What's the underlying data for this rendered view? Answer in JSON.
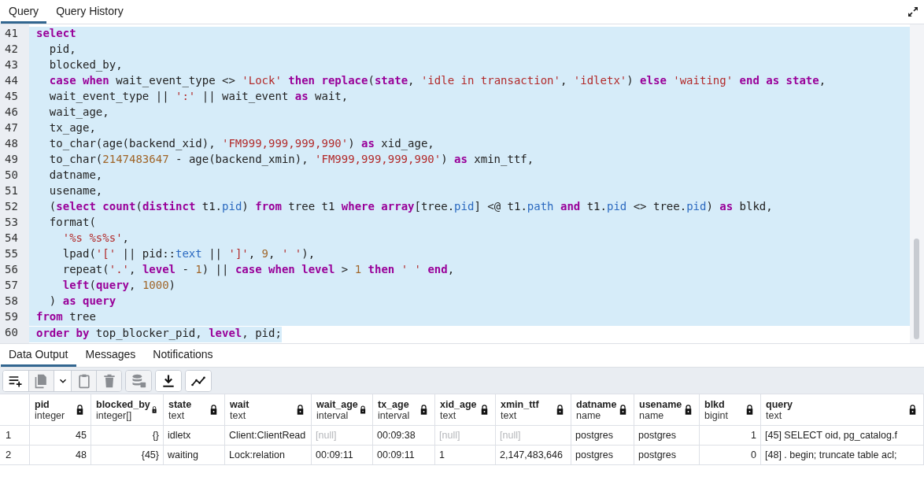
{
  "top_tabs": [
    {
      "label": "Query",
      "selected": true
    },
    {
      "label": "Query History",
      "selected": false
    }
  ],
  "editor": {
    "lines": [
      {
        "n": "41",
        "selected": true,
        "tokens": [
          {
            "kind": "kw",
            "text": "select"
          }
        ]
      },
      {
        "n": "42",
        "selected": true,
        "tokens": [
          {
            "kind": "p",
            "text": "  pid,"
          }
        ]
      },
      {
        "n": "43",
        "selected": true,
        "tokens": [
          {
            "kind": "p",
            "text": "  blocked_by,"
          }
        ]
      },
      {
        "n": "44",
        "selected": true,
        "tokens": [
          {
            "kind": "kw",
            "text": "  case when "
          },
          {
            "kind": "p",
            "text": "wait_event_type <> "
          },
          {
            "kind": "str",
            "text": "'Lock' "
          },
          {
            "kind": "kw",
            "text": "then replace"
          },
          {
            "kind": "p",
            "text": "("
          },
          {
            "kind": "kw",
            "text": "state"
          },
          {
            "kind": "p",
            "text": ", "
          },
          {
            "kind": "str",
            "text": "'idle in transaction'"
          },
          {
            "kind": "p",
            "text": ", "
          },
          {
            "kind": "str",
            "text": "'idletx'"
          },
          {
            "kind": "p",
            "text": ") "
          },
          {
            "kind": "kw",
            "text": "else "
          },
          {
            "kind": "str",
            "text": "'waiting' "
          },
          {
            "kind": "kw",
            "text": "end as state"
          },
          {
            "kind": "p",
            "text": ","
          }
        ]
      },
      {
        "n": "45",
        "selected": true,
        "tokens": [
          {
            "kind": "p",
            "text": "  wait_event_type || "
          },
          {
            "kind": "str",
            "text": "':'"
          },
          {
            "kind": "p",
            "text": " || wait_event "
          },
          {
            "kind": "kw",
            "text": "as"
          },
          {
            "kind": "p",
            "text": " wait,"
          }
        ]
      },
      {
        "n": "46",
        "selected": true,
        "tokens": [
          {
            "kind": "p",
            "text": "  wait_age,"
          }
        ]
      },
      {
        "n": "47",
        "selected": true,
        "tokens": [
          {
            "kind": "p",
            "text": "  tx_age,"
          }
        ]
      },
      {
        "n": "48",
        "selected": true,
        "tokens": [
          {
            "kind": "p",
            "text": "  to_char(age(backend_xid), "
          },
          {
            "kind": "str",
            "text": "'FM999,999,999,990'"
          },
          {
            "kind": "p",
            "text": ") "
          },
          {
            "kind": "kw",
            "text": "as"
          },
          {
            "kind": "p",
            "text": " xid_age,"
          }
        ]
      },
      {
        "n": "49",
        "selected": true,
        "tokens": [
          {
            "kind": "p",
            "text": "  to_char("
          },
          {
            "kind": "num",
            "text": "2147483647"
          },
          {
            "kind": "p",
            "text": " - age(backend_xmin), "
          },
          {
            "kind": "str",
            "text": "'FM999,999,999,990'"
          },
          {
            "kind": "p",
            "text": ") "
          },
          {
            "kind": "kw",
            "text": "as"
          },
          {
            "kind": "p",
            "text": " xmin_ttf,"
          }
        ]
      },
      {
        "n": "50",
        "selected": true,
        "tokens": [
          {
            "kind": "p",
            "text": "  datname,"
          }
        ]
      },
      {
        "n": "51",
        "selected": true,
        "tokens": [
          {
            "kind": "p",
            "text": "  usename,"
          }
        ]
      },
      {
        "n": "52",
        "selected": true,
        "tokens": [
          {
            "kind": "p",
            "text": "  ("
          },
          {
            "kind": "kw",
            "text": "select count"
          },
          {
            "kind": "p",
            "text": "("
          },
          {
            "kind": "kw",
            "text": "distinct"
          },
          {
            "kind": "p",
            "text": " t1."
          },
          {
            "kind": "ty",
            "text": "pid"
          },
          {
            "kind": "p",
            "text": ") "
          },
          {
            "kind": "kw",
            "text": "from"
          },
          {
            "kind": "p",
            "text": " tree t1 "
          },
          {
            "kind": "kw",
            "text": "where array"
          },
          {
            "kind": "p",
            "text": "[tree."
          },
          {
            "kind": "ty",
            "text": "pid"
          },
          {
            "kind": "p",
            "text": "] <@ t1."
          },
          {
            "kind": "ty",
            "text": "path"
          },
          {
            "kind": "kw",
            "text": " and"
          },
          {
            "kind": "p",
            "text": " t1."
          },
          {
            "kind": "ty",
            "text": "pid"
          },
          {
            "kind": "p",
            "text": " <> tree."
          },
          {
            "kind": "ty",
            "text": "pid"
          },
          {
            "kind": "p",
            "text": ") "
          },
          {
            "kind": "kw",
            "text": "as"
          },
          {
            "kind": "p",
            "text": " blkd,"
          }
        ]
      },
      {
        "n": "53",
        "selected": true,
        "tokens": [
          {
            "kind": "p",
            "text": "  format("
          }
        ]
      },
      {
        "n": "54",
        "selected": true,
        "tokens": [
          {
            "kind": "str",
            "text": "    '%s %s%s'"
          },
          {
            "kind": "p",
            "text": ","
          }
        ]
      },
      {
        "n": "55",
        "selected": true,
        "tokens": [
          {
            "kind": "p",
            "text": "    lpad("
          },
          {
            "kind": "str",
            "text": "'['"
          },
          {
            "kind": "p",
            "text": " || pid::"
          },
          {
            "kind": "ty",
            "text": "text"
          },
          {
            "kind": "p",
            "text": " || "
          },
          {
            "kind": "str",
            "text": "']'"
          },
          {
            "kind": "p",
            "text": ", "
          },
          {
            "kind": "num",
            "text": "9"
          },
          {
            "kind": "p",
            "text": ", "
          },
          {
            "kind": "str",
            "text": "' '"
          },
          {
            "kind": "p",
            "text": "),"
          }
        ]
      },
      {
        "n": "56",
        "selected": true,
        "tokens": [
          {
            "kind": "p",
            "text": "    repeat("
          },
          {
            "kind": "str",
            "text": "'.'"
          },
          {
            "kind": "p",
            "text": ", "
          },
          {
            "kind": "kw",
            "text": "level"
          },
          {
            "kind": "p",
            "text": " - "
          },
          {
            "kind": "num",
            "text": "1"
          },
          {
            "kind": "p",
            "text": ") || "
          },
          {
            "kind": "kw",
            "text": "case when level"
          },
          {
            "kind": "p",
            "text": " > "
          },
          {
            "kind": "num",
            "text": "1"
          },
          {
            "kind": "kw",
            "text": " then "
          },
          {
            "kind": "str",
            "text": "' ' "
          },
          {
            "kind": "kw",
            "text": "end"
          },
          {
            "kind": "p",
            "text": ","
          }
        ]
      },
      {
        "n": "57",
        "selected": true,
        "tokens": [
          {
            "kind": "kw",
            "text": "    left"
          },
          {
            "kind": "p",
            "text": "("
          },
          {
            "kind": "kw",
            "text": "query"
          },
          {
            "kind": "p",
            "text": ", "
          },
          {
            "kind": "num",
            "text": "1000"
          },
          {
            "kind": "p",
            "text": ")"
          }
        ]
      },
      {
        "n": "58",
        "selected": true,
        "tokens": [
          {
            "kind": "p",
            "text": "  ) "
          },
          {
            "kind": "kw",
            "text": "as query"
          }
        ]
      },
      {
        "n": "59",
        "selected": true,
        "tokens": [
          {
            "kind": "kw",
            "text": "from"
          },
          {
            "kind": "p",
            "text": " tree"
          }
        ]
      },
      {
        "n": "60",
        "selected": true,
        "tokens": [
          {
            "kind": "kw",
            "text": "order by"
          },
          {
            "kind": "p",
            "text": " top_blocker_pid, "
          },
          {
            "kind": "kw",
            "text": "level"
          },
          {
            "kind": "p",
            "text": ", pid;"
          }
        ]
      }
    ]
  },
  "result_tabs": [
    {
      "label": "Data Output",
      "selected": true
    },
    {
      "label": "Messages",
      "selected": false
    },
    {
      "label": "Notifications",
      "selected": false
    }
  ],
  "toolbar": [
    {
      "kind": "add-row",
      "disabled": false
    },
    {
      "kind": "copy",
      "disabled": true
    },
    {
      "kind": "caret",
      "disabled": false
    },
    {
      "kind": "paste",
      "disabled": true
    },
    {
      "kind": "delete",
      "disabled": true
    },
    {
      "kind": "save-data",
      "disabled": true
    },
    {
      "kind": "download",
      "disabled": false
    },
    {
      "kind": "graph",
      "disabled": false
    }
  ],
  "table": {
    "columns": [
      {
        "name": "pid",
        "type": "integer",
        "numeric": true
      },
      {
        "name": "blocked_by",
        "type": "integer[]",
        "numeric": true
      },
      {
        "name": "state",
        "type": "text",
        "numeric": false
      },
      {
        "name": "wait",
        "type": "text",
        "numeric": false
      },
      {
        "name": "wait_age",
        "type": "interval",
        "numeric": false
      },
      {
        "name": "tx_age",
        "type": "interval",
        "numeric": false
      },
      {
        "name": "xid_age",
        "type": "text",
        "numeric": false
      },
      {
        "name": "xmin_ttf",
        "type": "text",
        "numeric": false
      },
      {
        "name": "datname",
        "type": "name",
        "numeric": false
      },
      {
        "name": "usename",
        "type": "name",
        "numeric": false
      },
      {
        "name": "blkd",
        "type": "bigint",
        "numeric": true
      },
      {
        "name": "query",
        "type": "text",
        "numeric": false
      }
    ],
    "rows": [
      {
        "n": "1",
        "cells": [
          {
            "v": "45",
            "null": false
          },
          {
            "v": "{}",
            "null": false
          },
          {
            "v": "idletx",
            "null": false
          },
          {
            "v": "Client:ClientRead",
            "null": false
          },
          {
            "v": "[null]",
            "null": true
          },
          {
            "v": "00:09:38",
            "null": false
          },
          {
            "v": "[null]",
            "null": true
          },
          {
            "v": "[null]",
            "null": true
          },
          {
            "v": "postgres",
            "null": false
          },
          {
            "v": "postgres",
            "null": false
          },
          {
            "v": "1",
            "null": false
          },
          {
            "v": "[45] SELECT oid, pg_catalog.f",
            "null": false
          }
        ]
      },
      {
        "n": "2",
        "cells": [
          {
            "v": "48",
            "null": false
          },
          {
            "v": "{45}",
            "null": false
          },
          {
            "v": "waiting",
            "null": false
          },
          {
            "v": "Lock:relation",
            "null": false
          },
          {
            "v": "00:09:11",
            "null": false
          },
          {
            "v": "00:09:11",
            "null": false
          },
          {
            "v": "1",
            "null": false
          },
          {
            "v": "2,147,483,646",
            "null": false
          },
          {
            "v": "postgres",
            "null": false
          },
          {
            "v": "postgres",
            "null": false
          },
          {
            "v": "0",
            "null": false
          },
          {
            "v": "[48] . begin; truncate table acl;",
            "null": false
          }
        ]
      }
    ]
  }
}
